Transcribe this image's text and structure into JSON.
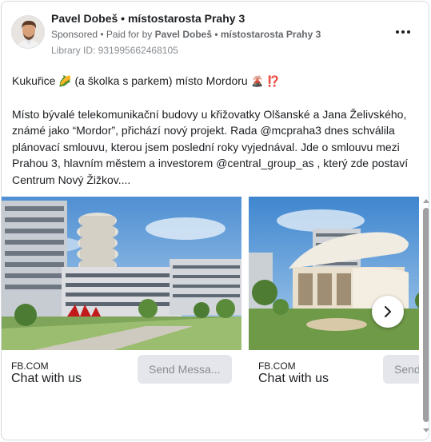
{
  "post": {
    "advertiser": "Pavel Dobeš • místostarosta Prahy 3",
    "sponsored": "Sponsored",
    "paid_for_prefix": "• Paid for by",
    "paid_for_name": "Pavel Dobeš • místostarosta Prahy 3",
    "library_id": "Library ID: 931995662468105",
    "more_icon": "more-horizontal-icon"
  },
  "body": {
    "line1_a": "Kukuřice",
    "line1_b": "(a školka s parkem) místo Mordoru",
    "paragraph": "Místo bývalé telekomunikační budovy u křižovatky Olšanské a Jana Želivského, známé jako “Mordor”, přichází nový projekt. Rada @mcpraha3 dnes schválila plánovací smlouvu, kterou jsem poslední roky vyjednával. Jde o smlouvu mezi Prahou 3, hlavním městem a investorem @central_group_as , který zde postaví Centrum Nový Žižkov...."
  },
  "carousel": {
    "slides": [
      {
        "source": "FB.COM",
        "cta": "Chat with us",
        "button": "Send Messa..."
      },
      {
        "source": "FB.COM",
        "cta": "Chat with us",
        "button": "Send Messa..."
      }
    ],
    "next_icon": "chevron-right-icon"
  },
  "colors": {
    "text": "#1c1e21",
    "secondary": "#65676b",
    "button_bg": "#e4e6eb"
  }
}
